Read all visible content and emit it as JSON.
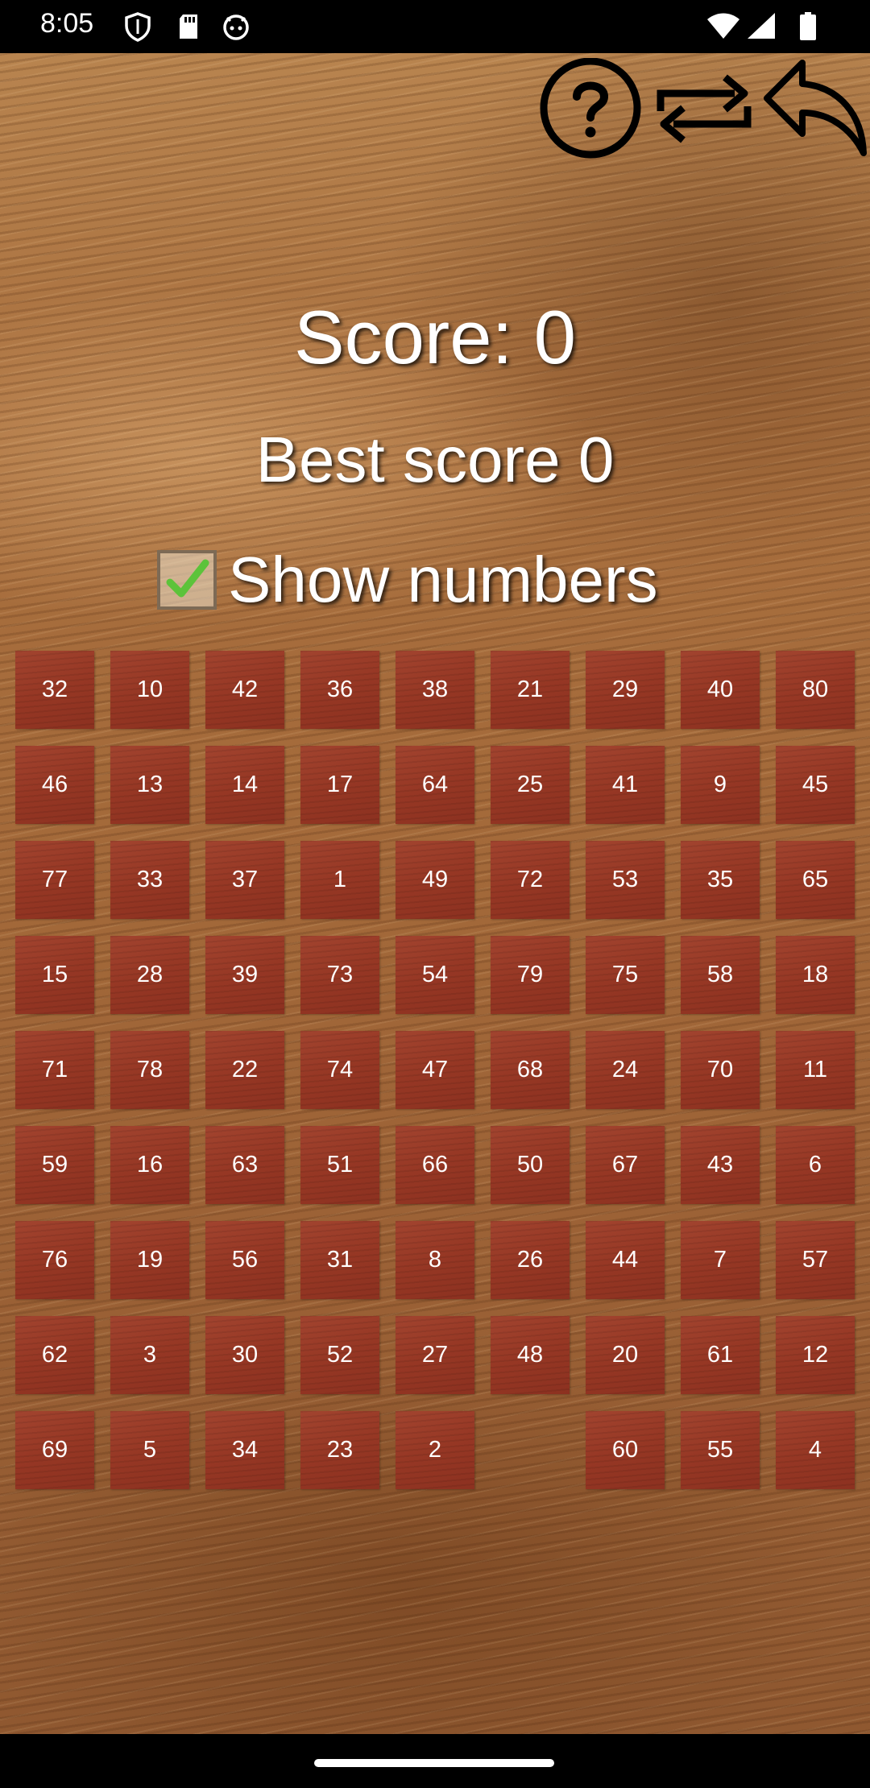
{
  "status_bar": {
    "time": "8:05",
    "left_icons": [
      "shield-icon",
      "sd-card-icon",
      "android-icon"
    ],
    "right_icons": [
      "wifi-icon",
      "signal-icon",
      "battery-icon"
    ]
  },
  "toolbar": {
    "icons": [
      "help-icon",
      "restart-icon",
      "back-icon"
    ]
  },
  "score": {
    "label": "Score:",
    "value": "0",
    "text": "Score: 0"
  },
  "best_score": {
    "label": "Best score",
    "value": "0",
    "text": "Best score  0"
  },
  "show_numbers": {
    "label": "Show numbers",
    "checked": true
  },
  "board": {
    "columns": 9,
    "rows": [
      [
        "32",
        "10",
        "42",
        "36",
        "38",
        "21",
        "29",
        "40",
        "80"
      ],
      [
        "46",
        "13",
        "14",
        "17",
        "64",
        "25",
        "41",
        "9",
        "45"
      ],
      [
        "77",
        "33",
        "37",
        "1",
        "49",
        "72",
        "53",
        "35",
        "65"
      ],
      [
        "15",
        "28",
        "39",
        "73",
        "54",
        "79",
        "75",
        "58",
        "18"
      ],
      [
        "71",
        "78",
        "22",
        "74",
        "47",
        "68",
        "24",
        "70",
        "11"
      ],
      [
        "59",
        "16",
        "63",
        "51",
        "66",
        "50",
        "67",
        "43",
        "6"
      ],
      [
        "76",
        "19",
        "56",
        "31",
        "8",
        "26",
        "44",
        "7",
        "57"
      ],
      [
        "62",
        "3",
        "30",
        "52",
        "27",
        "48",
        "20",
        "61",
        "12"
      ],
      [
        "69",
        "5",
        "34",
        "23",
        "2",
        "",
        "60",
        "55",
        "4"
      ]
    ]
  },
  "colors": {
    "tile": "#963724",
    "wood": "#a46a3a",
    "check": "#5cc33a"
  }
}
